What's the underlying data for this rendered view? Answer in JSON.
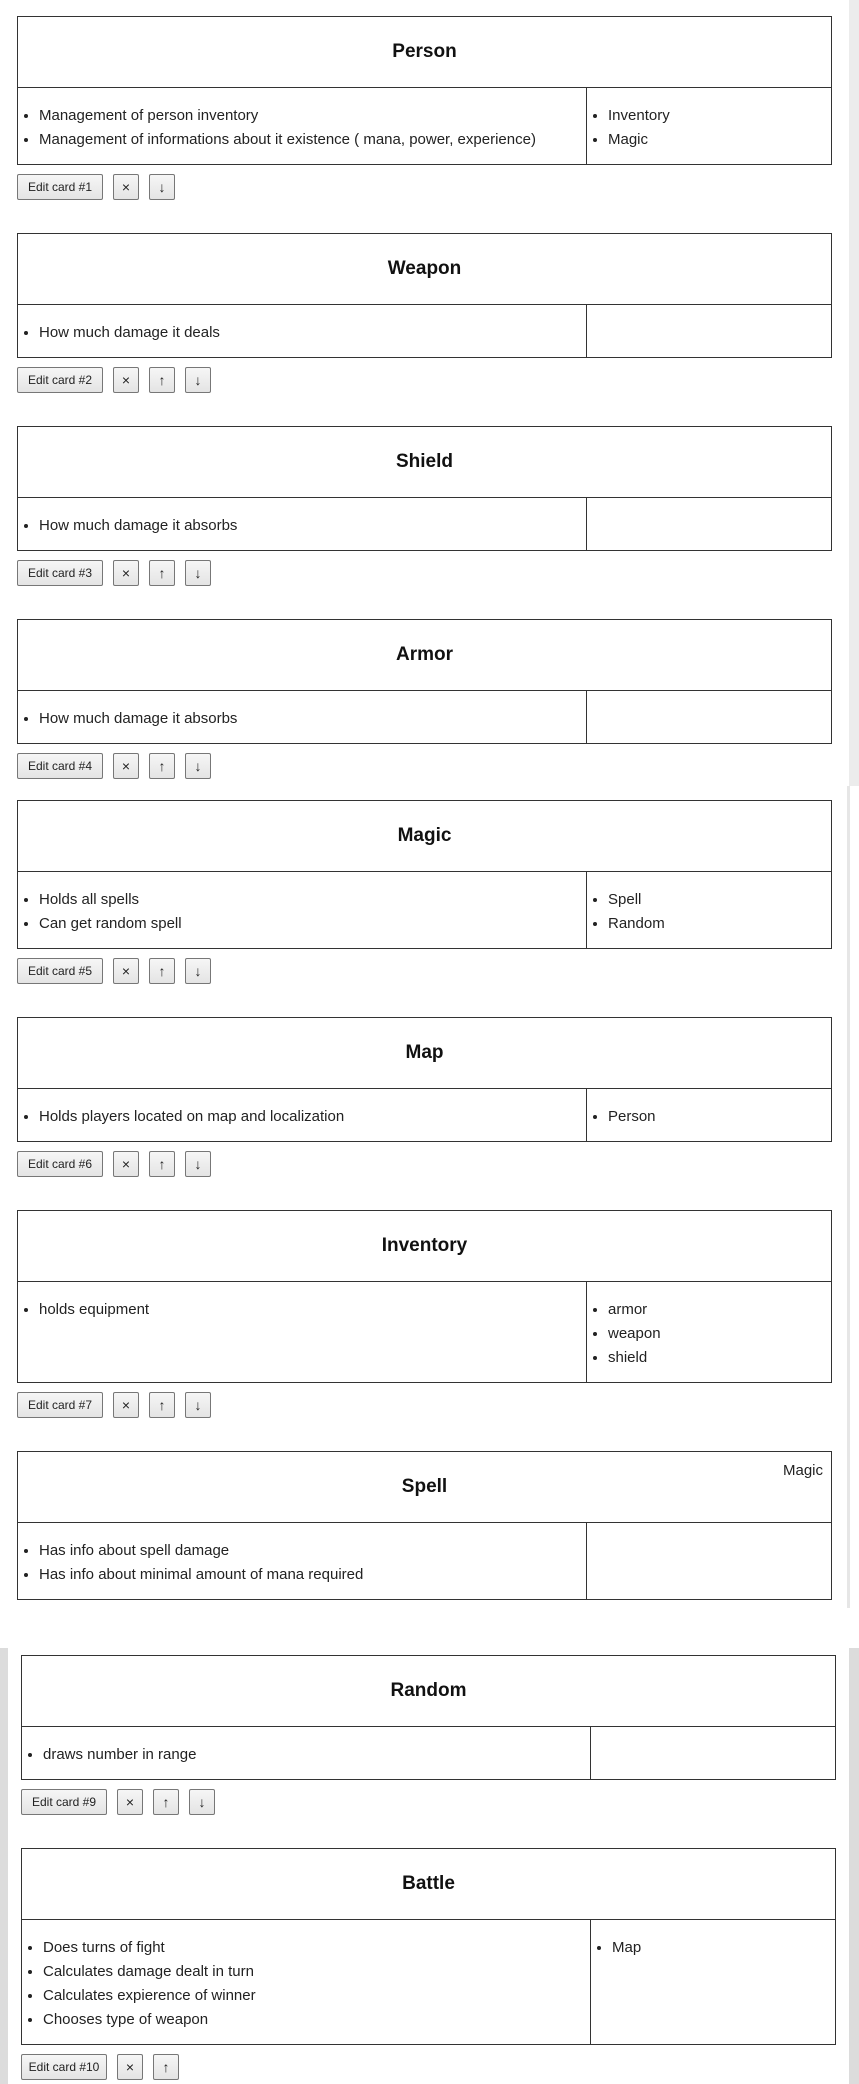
{
  "cards": [
    {
      "title": "Person",
      "corner": "",
      "resp": [
        "Management of person inventory",
        "Management of informations about it existence ( mana, power, experience)"
      ],
      "collab": [
        "Inventory",
        "Magic"
      ],
      "edit_label": "Edit card #1",
      "delete_icon": "×",
      "up_icon": "",
      "down_icon": "↓"
    },
    {
      "title": "Weapon",
      "corner": "",
      "resp": [
        "How much damage it deals"
      ],
      "collab": [],
      "edit_label": "Edit card #2",
      "delete_icon": "×",
      "up_icon": "↑",
      "down_icon": "↓"
    },
    {
      "title": "Shield",
      "corner": "",
      "resp": [
        "How much damage it absorbs"
      ],
      "collab": [],
      "edit_label": "Edit card #3",
      "delete_icon": "×",
      "up_icon": "↑",
      "down_icon": "↓"
    },
    {
      "title": "Armor",
      "corner": "",
      "resp": [
        "How much damage it absorbs"
      ],
      "collab": [],
      "edit_label": "Edit card #4",
      "delete_icon": "×",
      "up_icon": "↑",
      "down_icon": "↓"
    },
    {
      "title": "Magic",
      "corner": "",
      "resp": [
        "Holds all spells",
        "Can get random spell"
      ],
      "collab": [
        "Spell",
        "Random"
      ],
      "edit_label": "Edit card #5",
      "delete_icon": "×",
      "up_icon": "↑",
      "down_icon": "↓"
    },
    {
      "title": "Map",
      "corner": "",
      "resp": [
        "Holds players located on map and localization"
      ],
      "collab": [
        "Person"
      ],
      "edit_label": "Edit card #6",
      "delete_icon": "×",
      "up_icon": "↑",
      "down_icon": "↓"
    },
    {
      "title": "Inventory",
      "corner": "",
      "resp": [
        "holds equipment"
      ],
      "collab": [
        "armor",
        "weapon",
        "shield"
      ],
      "edit_label": "Edit card #7",
      "delete_icon": "×",
      "up_icon": "↑",
      "down_icon": "↓"
    },
    {
      "title": "Spell",
      "corner": "Magic",
      "resp": [
        "Has info about spell damage",
        "Has info about minimal amount of mana required"
      ],
      "collab": [],
      "edit_label": "",
      "delete_icon": "",
      "up_icon": "",
      "down_icon": ""
    },
    {
      "title": "Random",
      "corner": "",
      "resp": [
        "draws number in range"
      ],
      "collab": [],
      "edit_label": "Edit card #9",
      "delete_icon": "×",
      "up_icon": "↑",
      "down_icon": "↓"
    },
    {
      "title": "Battle",
      "corner": "",
      "resp": [
        "Does turns of fight",
        "Calculates damage dealt in turn",
        "Calculates expierence of winner",
        "Chooses type of weapon"
      ],
      "collab": [
        "Map"
      ],
      "edit_label": "Edit card #10",
      "delete_icon": "×",
      "up_icon": "↑",
      "down_icon": ""
    }
  ]
}
